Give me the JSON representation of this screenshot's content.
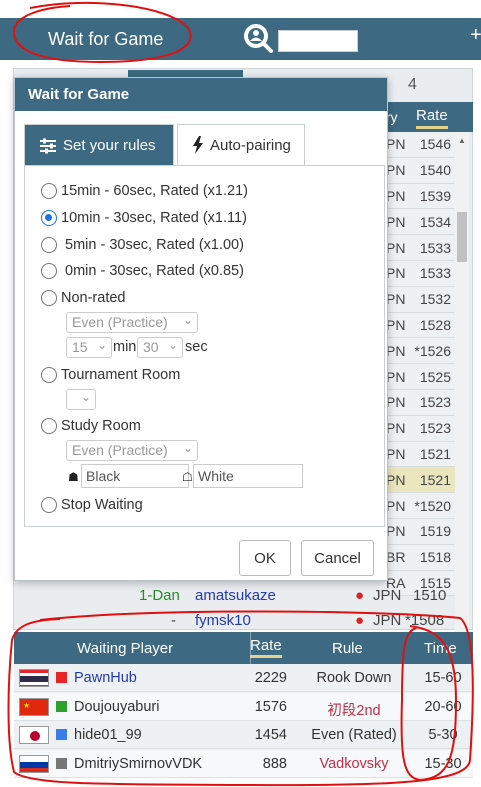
{
  "topbar": {
    "title": "Wait for Game",
    "search_icon": "search-user-icon",
    "plus": "+"
  },
  "background": {
    "tab_number": "4",
    "col_country": "try",
    "col_rate": "Rate",
    "rows": [
      {
        "cc": "PN",
        "rate": "1546"
      },
      {
        "cc": "PN",
        "rate": "1540"
      },
      {
        "cc": "PN",
        "rate": "1539"
      },
      {
        "cc": "PN",
        "rate": "1534"
      },
      {
        "cc": "PN",
        "rate": "1533"
      },
      {
        "cc": "PN",
        "rate": "1533"
      },
      {
        "cc": "PN",
        "rate": "1532"
      },
      {
        "cc": "PN",
        "rate": "1528"
      },
      {
        "cc": "PN",
        "rate": "*1526"
      },
      {
        "cc": "PN",
        "rate": "1525"
      },
      {
        "cc": "PN",
        "rate": "1523"
      },
      {
        "cc": "PN",
        "rate": "1523"
      },
      {
        "cc": "PN",
        "rate": "1521"
      },
      {
        "cc": "PN",
        "rate": "1521"
      },
      {
        "cc": "PN",
        "rate": "*1520"
      },
      {
        "cc": "PN",
        "rate": "1519"
      },
      {
        "cc": "BR",
        "rate": "1518"
      },
      {
        "cc": "RA",
        "rate": "1515"
      }
    ],
    "line1": {
      "level": "1-Dan",
      "name": "amatsukaze",
      "cc": "JPN",
      "rate": "1510"
    },
    "line2": {
      "level": "-",
      "name": "fymsk10",
      "cc": "JPN",
      "rate": "*1508"
    }
  },
  "dialog": {
    "title": "Wait for Game",
    "tab_rules": "Set your rules",
    "tab_auto": "Auto-pairing",
    "options": {
      "o1": "15min - 60sec, Rated (x1.21)",
      "o2": "10min - 30sec, Rated (x1.11)",
      "o3": " 5min - 30sec, Rated (x1.00)",
      "o4": " 0min - 30sec, Rated (x0.85)",
      "nonrated": "Non-rated",
      "tournament": "Tournament Room",
      "study": "Study Room",
      "stop": "Stop Waiting"
    },
    "selected_option": "o2",
    "nonrated_handicap": "Even (Practice)",
    "nonrated_minutes": "15",
    "min_label": "min",
    "nonrated_seconds": "30",
    "sec_label": "sec",
    "tournament_select": "",
    "study_handicap": "Even (Practice)",
    "study_black_placeholder": "Black",
    "study_white_placeholder": "White",
    "ok": "OK",
    "cancel": "Cancel"
  },
  "waiting": {
    "headers": {
      "player": "Waiting Player",
      "rate": "Rate",
      "rule": "Rule",
      "time": "Time"
    },
    "rows": [
      {
        "flag": "thailand",
        "square": "#e82424",
        "player": "PawnHub",
        "rate": "2229",
        "rule": "Rook Down",
        "rule_color": "#333333",
        "time": "15-60",
        "player_color": "#2439b3"
      },
      {
        "flag": "china",
        "square": "#2ea02e",
        "player": "Doujouyaburi",
        "rate": "1576",
        "rule": "初段2nd",
        "rule_color": "#c0304a",
        "time": "20-60",
        "player_color": "#333333"
      },
      {
        "flag": "japan",
        "square": "#3b7de8",
        "player": "hide01_99",
        "rate": "1454",
        "rule": "Even (Rated)",
        "rule_color": "#333333",
        "time": "5-30",
        "player_color": "#333333"
      },
      {
        "flag": "russia",
        "square": "#777777",
        "player": "DmitriySmirnovVDK",
        "rate": "888",
        "rule": "Vadkovsky",
        "rule_color": "#c0304a",
        "time": "15-30",
        "player_color": "#333333"
      }
    ]
  },
  "colors": {
    "header": "#3d6a82",
    "accent_underline": "#e6d38a",
    "annotation": "#e01010"
  }
}
